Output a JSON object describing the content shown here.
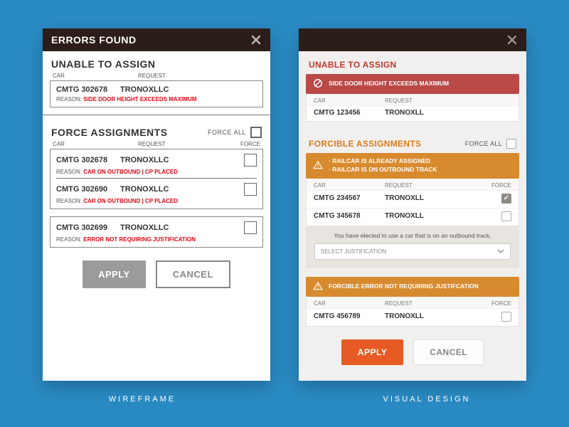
{
  "captions": {
    "left": "WIREFRAME",
    "right": "VISUAL DESIGN"
  },
  "wireframe": {
    "header_title": "ERRORS FOUND",
    "unable_title": "UNABLE TO ASSIGN",
    "col_car": "CAR",
    "col_request": "REQUEST",
    "col_force": "FORCE",
    "reason_label": "REASON:",
    "unable_rows": [
      {
        "car": "CMTG 302678",
        "request": "TRONOXLLC",
        "reason": "SIDE DOOR HEIGHT EXCEEDS MAXIMUM"
      }
    ],
    "force_title": "FORCE ASSIGNMENTS",
    "force_all_label": "FORCE ALL",
    "force_groups": [
      {
        "rows": [
          {
            "car": "CMTG 302678",
            "request": "TRONOXLLC",
            "reason": "CAR ON OUTBOUND | CP PLACED"
          },
          {
            "car": "CMTG 302690",
            "request": "TRONOXLLC",
            "reason": "CAR ON OUTBOUND | CP PLACED"
          }
        ]
      },
      {
        "rows": [
          {
            "car": "CMTG 302699",
            "request": "TRONOXLLC",
            "reason": "ERROR NOT REQUIRING JUSTIFICATION"
          }
        ]
      }
    ],
    "apply_label": "APPLY",
    "cancel_label": "CANCEL"
  },
  "visual": {
    "unable_title": "UNABLE TO ASSIGN",
    "col_car": "CAR",
    "col_request": "REQUEST",
    "col_force": "FORCE",
    "unable_banner": "SIDE DOOR HEIGHT EXCEEDS MAXIMUM",
    "unable_rows": [
      {
        "car": "CMTG 123456",
        "request": "TRONOXLL"
      }
    ],
    "forcible_title": "FORCIBLE ASSIGNMENTS",
    "force_all_label": "FORCE ALL",
    "forcible_group1": {
      "banner_lines": [
        "RAILCAR IS ALREADY ASSIGNED",
        "RAILCAR IS ON OUTBOUND TRACK"
      ],
      "rows": [
        {
          "car": "CMTG 234567",
          "request": "TRONOXLL",
          "checked": true
        },
        {
          "car": "CMTG 345678",
          "request": "TRONOXLL",
          "checked": false
        }
      ]
    },
    "justify_msg": "You have elected to use a car that is on an outbound track.",
    "justify_placeholder": "SELECT JUSTIFICATION",
    "forcible_group2": {
      "banner": "FORCIBLE ERROR NOT REQUIRING JUSTIFCATION",
      "rows": [
        {
          "car": "CMTG 456789",
          "request": "TRONOXLL",
          "checked": false
        }
      ]
    },
    "apply_label": "APPLY",
    "cancel_label": "CANCEL"
  }
}
